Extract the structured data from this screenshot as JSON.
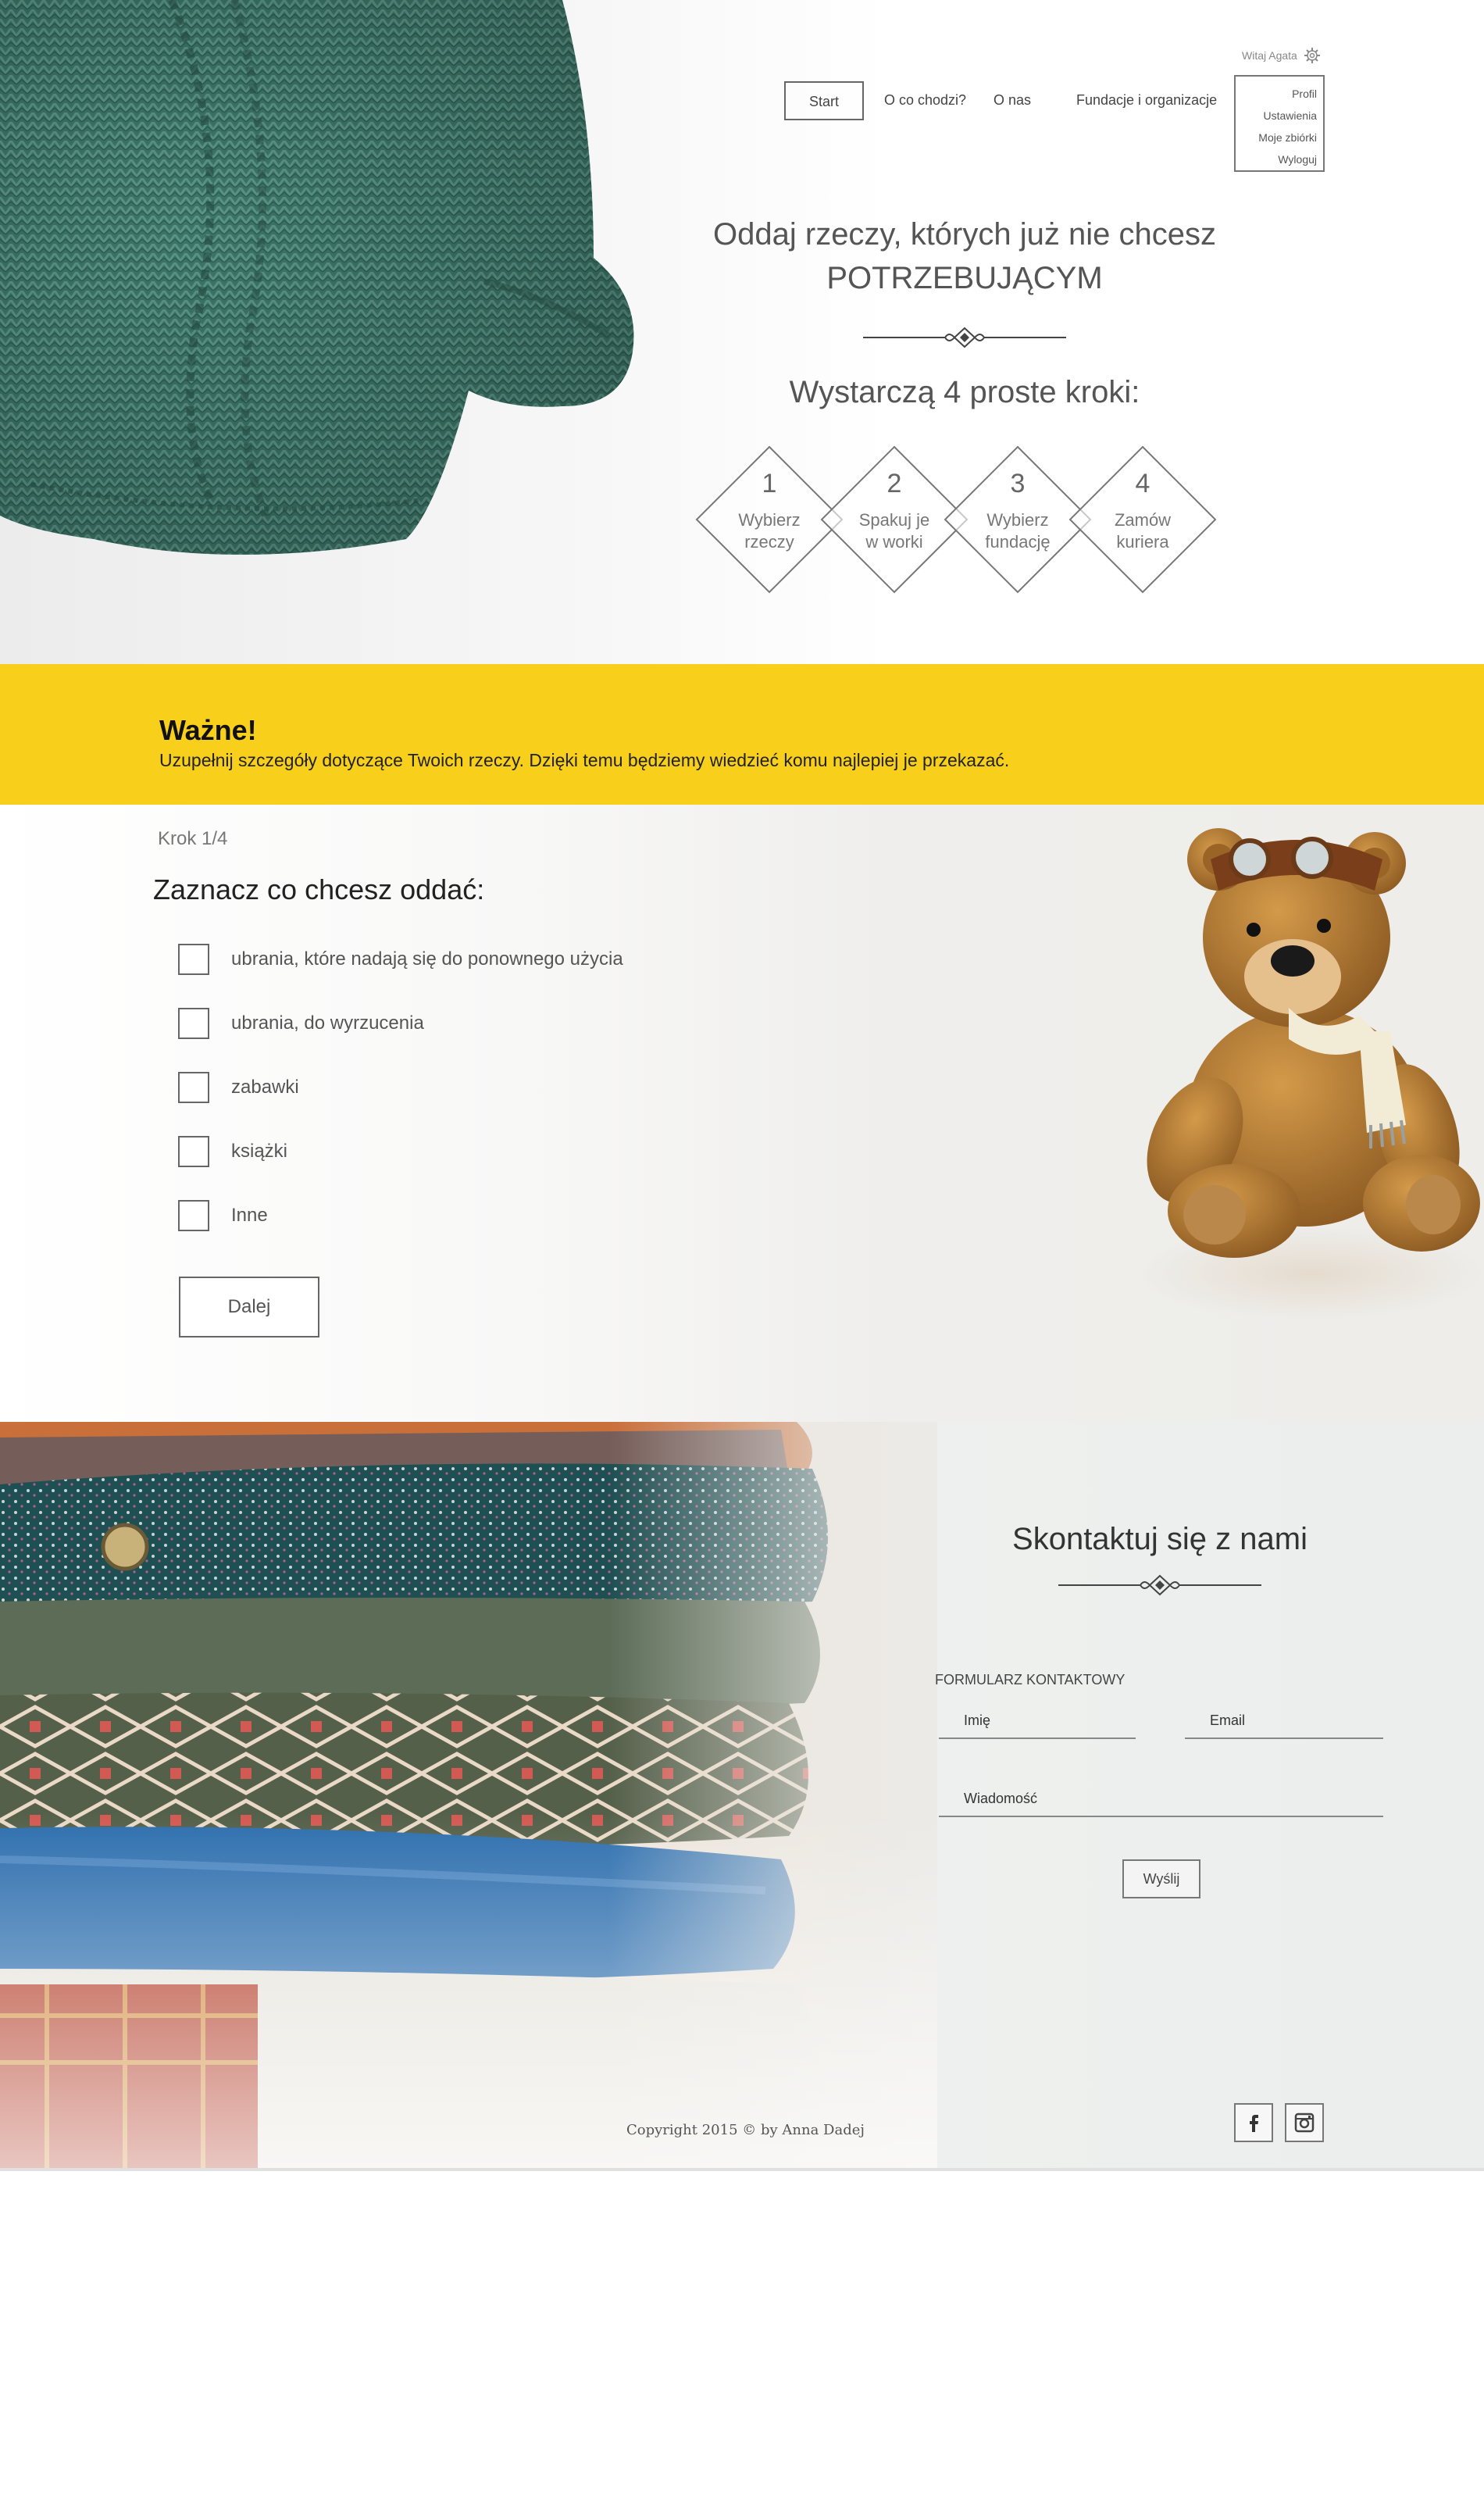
{
  "header": {
    "welcome": "Witaj Agata",
    "nav": [
      "Start",
      "O co chodzi?",
      "O nas",
      "Fundacje i organizacje"
    ],
    "user_menu": [
      "Profil",
      "Ustawienia",
      "Moje zbiórki",
      "Wyloguj"
    ]
  },
  "hero": {
    "title_line1": "Oddaj rzeczy, których już nie chcesz",
    "title_line2": "POTRZEBUJĄCYM",
    "steps_title": "Wystarczą 4 proste kroki:",
    "steps": [
      {
        "num": "1",
        "line1": "Wybierz",
        "line2": "rzeczy"
      },
      {
        "num": "2",
        "line1": "Spakuj je",
        "line2": "w worki"
      },
      {
        "num": "3",
        "line1": "Wybierz",
        "line2": "fundację"
      },
      {
        "num": "4",
        "line1": "Zamów",
        "line2": "kuriera"
      }
    ]
  },
  "notice": {
    "heading": "Ważne!",
    "text": "Uzupełnij szczegóły dotyczące Twoich rzeczy. Dzięki temu będziemy wiedzieć komu najlepiej je przekazać."
  },
  "form_step": {
    "step_label": "Krok 1/4",
    "question": "Zaznacz co chcesz oddać:",
    "options": [
      "ubrania, które nadają się do ponownego użycia",
      "ubrania, do wyrzucenia",
      "zabawki",
      "książki",
      "Inne"
    ],
    "next_label": "Dalej"
  },
  "contact": {
    "title": "Skontaktuj się z nami",
    "form_label": "FORMULARZ KONTAKTOWY",
    "name_placeholder": "Imię",
    "email_placeholder": "Email",
    "message_placeholder": "Wiadomość",
    "send_label": "Wyślij"
  },
  "footer": {
    "copyright": "Copyright 2015 ©  by Anna Dadej"
  },
  "colors": {
    "accent_yellow": "#f8cf1b",
    "sweater_green": "#3f7a6d",
    "text_gray": "#555555"
  },
  "icons": [
    "gear-icon",
    "ornament-divider",
    "facebook-icon",
    "instagram-icon"
  ]
}
